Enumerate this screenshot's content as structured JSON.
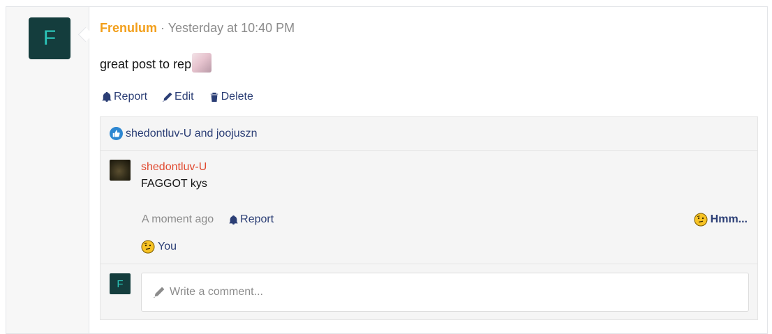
{
  "post": {
    "avatar_letter": "F",
    "author": "Frenulum",
    "separator": " · ",
    "timestamp": "Yesterday at 10:40 PM",
    "message": "great post to rep",
    "actions": {
      "report": "Report",
      "edit": "Edit",
      "delete": "Delete"
    }
  },
  "likes": {
    "text": "shedontluv-U and joojuszn"
  },
  "comment": {
    "author": "shedontluv-U",
    "text": "FAGGOT kys",
    "time": "A moment ago",
    "report": "Report",
    "reaction_label": "Hmm...",
    "reactor": "You"
  },
  "reply": {
    "avatar_letter": "F",
    "placeholder": "Write a comment..."
  },
  "colors": {
    "author": "#f29f1b",
    "link": "#2b3e75",
    "comment_author": "#e0492f",
    "avatar_bg": "#143d3d",
    "like": "#2d87d1"
  }
}
